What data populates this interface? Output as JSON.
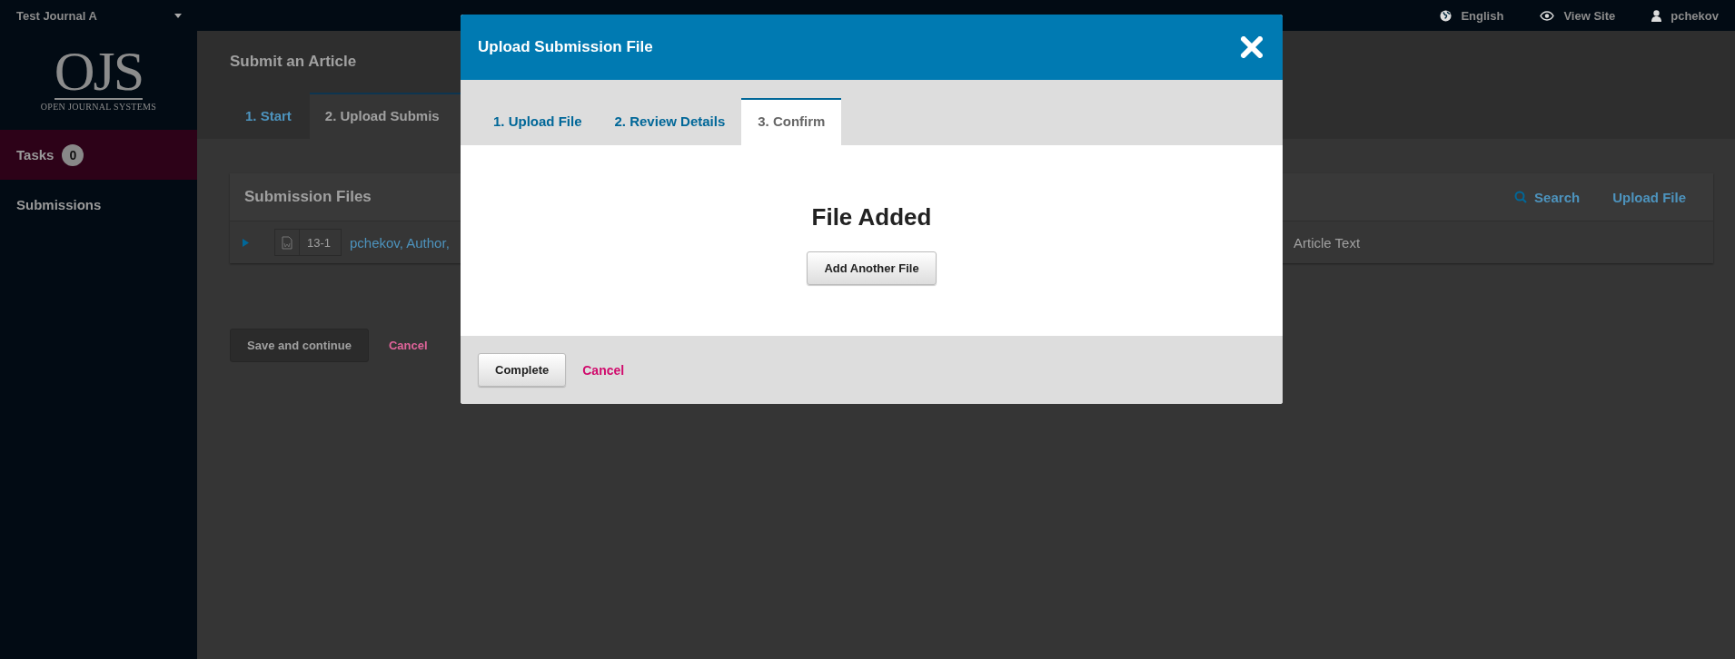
{
  "top_bar": {
    "journal": "Test Journal A",
    "links": [
      {
        "kind": "globe",
        "label": "English"
      },
      {
        "kind": "eye",
        "label": "View Site"
      },
      {
        "kind": "user",
        "label": "pchekov"
      }
    ]
  },
  "sidebar": {
    "logo": {
      "mark": "OJS",
      "caption": "OPEN JOURNAL SYSTEMS"
    },
    "items": [
      {
        "label": "Tasks",
        "badge": "0",
        "selected": true
      },
      {
        "label": "Submissions",
        "selected": false
      }
    ]
  },
  "page": {
    "title": "Submit an Article",
    "tabs": [
      {
        "label": "1. Start",
        "selected": false
      },
      {
        "label": "2. Upload Submis",
        "selected": true
      }
    ],
    "files_panel": {
      "title": "Submission Files",
      "actions": [
        {
          "kind": "search",
          "label": "Search"
        },
        {
          "kind": "plain",
          "label": "Upload File"
        }
      ],
      "rows": [
        {
          "file_id": "13-1",
          "name": "pchekov, Author,",
          "component": "Article Text"
        }
      ]
    },
    "buttons": {
      "primary": "Save and continue",
      "cancel": "Cancel"
    }
  },
  "modal": {
    "title": "Upload Submission File",
    "tabs": [
      {
        "label": "1. Upload File",
        "selected": false
      },
      {
        "label": "2. Review Details",
        "selected": false
      },
      {
        "label": "3. Confirm",
        "selected": true
      }
    ],
    "heading": "File Added",
    "add_button": "Add Another File",
    "footer": {
      "primary": "Complete",
      "cancel": "Cancel"
    }
  }
}
